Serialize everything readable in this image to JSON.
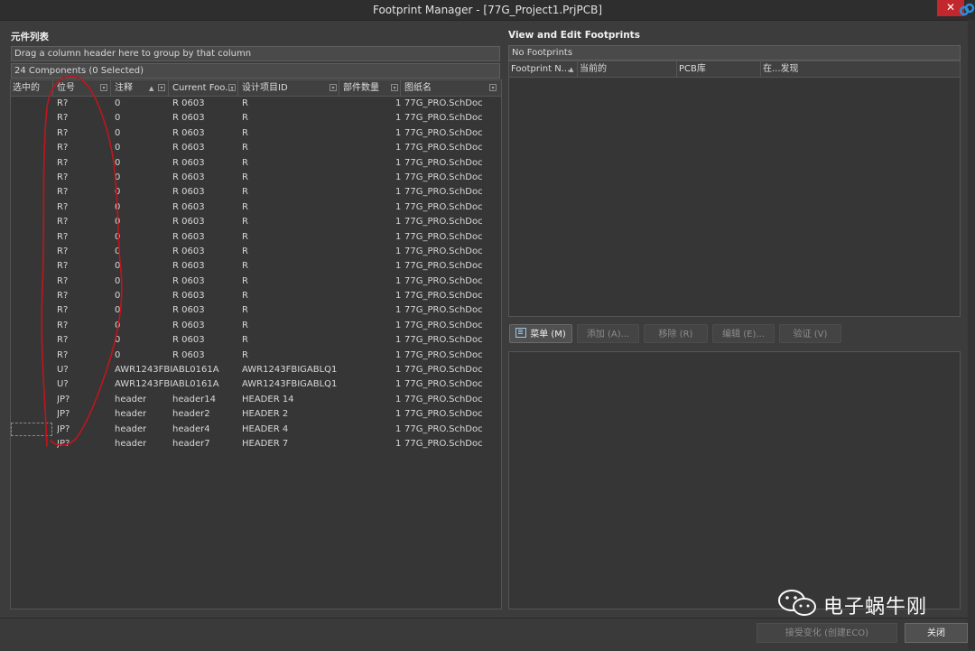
{
  "window": {
    "title": "Footprint Manager - [77G_Project1.PrjPCB]",
    "close_glyph": "✕"
  },
  "left_panel": {
    "title": "元件列表",
    "group_hint": "Drag a column header here to group by that column",
    "count_text": "24 Components (0 Selected)",
    "columns": [
      "选中的",
      "位号",
      "注释",
      "Current Foo...",
      "设计项目ID",
      "部件数量",
      "图纸名"
    ],
    "rows": [
      [
        "",
        "R?",
        "0",
        "R 0603",
        "R",
        "1",
        "77G_PRO.SchDoc"
      ],
      [
        "",
        "R?",
        "0",
        "R 0603",
        "R",
        "1",
        "77G_PRO.SchDoc"
      ],
      [
        "",
        "R?",
        "0",
        "R 0603",
        "R",
        "1",
        "77G_PRO.SchDoc"
      ],
      [
        "",
        "R?",
        "0",
        "R 0603",
        "R",
        "1",
        "77G_PRO.SchDoc"
      ],
      [
        "",
        "R?",
        "0",
        "R 0603",
        "R",
        "1",
        "77G_PRO.SchDoc"
      ],
      [
        "",
        "R?",
        "0",
        "R 0603",
        "R",
        "1",
        "77G_PRO.SchDoc"
      ],
      [
        "",
        "R?",
        "0",
        "R 0603",
        "R",
        "1",
        "77G_PRO.SchDoc"
      ],
      [
        "",
        "R?",
        "0",
        "R 0603",
        "R",
        "1",
        "77G_PRO.SchDoc"
      ],
      [
        "",
        "R?",
        "0",
        "R 0603",
        "R",
        "1",
        "77G_PRO.SchDoc"
      ],
      [
        "",
        "R?",
        "0",
        "R 0603",
        "R",
        "1",
        "77G_PRO.SchDoc"
      ],
      [
        "",
        "R?",
        "0",
        "R 0603",
        "R",
        "1",
        "77G_PRO.SchDoc"
      ],
      [
        "",
        "R?",
        "0",
        "R 0603",
        "R",
        "1",
        "77G_PRO.SchDoc"
      ],
      [
        "",
        "R?",
        "0",
        "R 0603",
        "R",
        "1",
        "77G_PRO.SchDoc"
      ],
      [
        "",
        "R?",
        "0",
        "R 0603",
        "R",
        "1",
        "77G_PRO.SchDoc"
      ],
      [
        "",
        "R?",
        "0",
        "R 0603",
        "R",
        "1",
        "77G_PRO.SchDoc"
      ],
      [
        "",
        "R?",
        "0",
        "R 0603",
        "R",
        "1",
        "77G_PRO.SchDoc"
      ],
      [
        "",
        "R?",
        "0",
        "R 0603",
        "R",
        "1",
        "77G_PRO.SchDoc"
      ],
      [
        "",
        "R?",
        "0",
        "R 0603",
        "R",
        "1",
        "77G_PRO.SchDoc"
      ],
      [
        "",
        "U?",
        "AWR1243FBI",
        "ABL0161A",
        "AWR1243FBIGABLQ1",
        "1",
        "77G_PRO.SchDoc"
      ],
      [
        "",
        "U?",
        "AWR1243FBI",
        "ABL0161A",
        "AWR1243FBIGABLQ1",
        "1",
        "77G_PRO.SchDoc"
      ],
      [
        "",
        "JP?",
        "header",
        "header14",
        "HEADER 14",
        "1",
        "77G_PRO.SchDoc"
      ],
      [
        "",
        "JP?",
        "header",
        "header2",
        "HEADER 2",
        "1",
        "77G_PRO.SchDoc"
      ],
      [
        "",
        "JP?",
        "header",
        "header4",
        "HEADER 4",
        "1",
        "77G_PRO.SchDoc"
      ],
      [
        "",
        "JP?",
        "header",
        "header7",
        "HEADER 7",
        "1",
        "77G_PRO.SchDoc"
      ]
    ]
  },
  "right_panel": {
    "title": "View and Edit Footprints",
    "no_footprints": "No Footprints",
    "columns": [
      "Footprint N...",
      "当前的",
      "PCB库",
      "在...发现"
    ],
    "buttons": {
      "menu": "菜单 (M)",
      "add": "添加 (A)...",
      "remove": "移除 (R)",
      "edit": "编辑 (E)...",
      "validate": "验证 (V)"
    }
  },
  "footer": {
    "accept": "接受变化 (创建ECO)",
    "close": "关闭"
  },
  "watermark": {
    "text": "电子蜗牛刚"
  },
  "colors": {
    "annotation": "#c0151c",
    "close_red": "#c1272d"
  }
}
